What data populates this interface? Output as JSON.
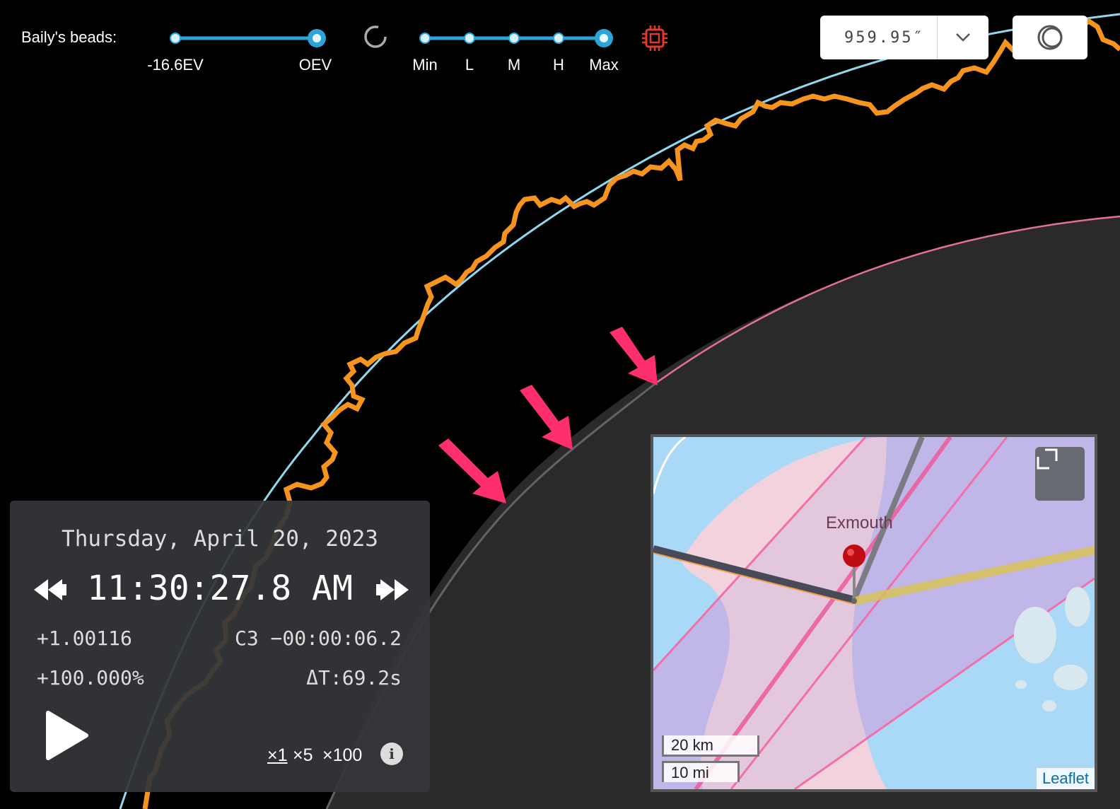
{
  "header": {
    "beads_label": "Baily's beads:",
    "exposure_labels": [
      "-16.6EV",
      "OEV"
    ],
    "quality_labels": [
      "Min",
      "L",
      "M",
      "H",
      "Max"
    ]
  },
  "limb": {
    "value": "959.95″"
  },
  "time_panel": {
    "date": "Thursday, April 20, 2023",
    "time": "11:30:27.8 AM",
    "magnitude": "+1.00116",
    "contact": "C3 −00:00:06.2",
    "coverage": "+100.000%",
    "delta_t": "ΔT:69.2s",
    "speeds": [
      "×1",
      "×5",
      "×100"
    ],
    "info": "i"
  },
  "map": {
    "town": "Exmouth",
    "scale_km": "20 km",
    "scale_mi": "10 mi",
    "attribution": "Leaflet"
  },
  "colors": {
    "accent": "#2aa5d8",
    "sun_limb": "#f7941d",
    "moon_limb": "#8fd8ee",
    "arrow": "#ff2f6d",
    "chip": "#e03b2a"
  }
}
